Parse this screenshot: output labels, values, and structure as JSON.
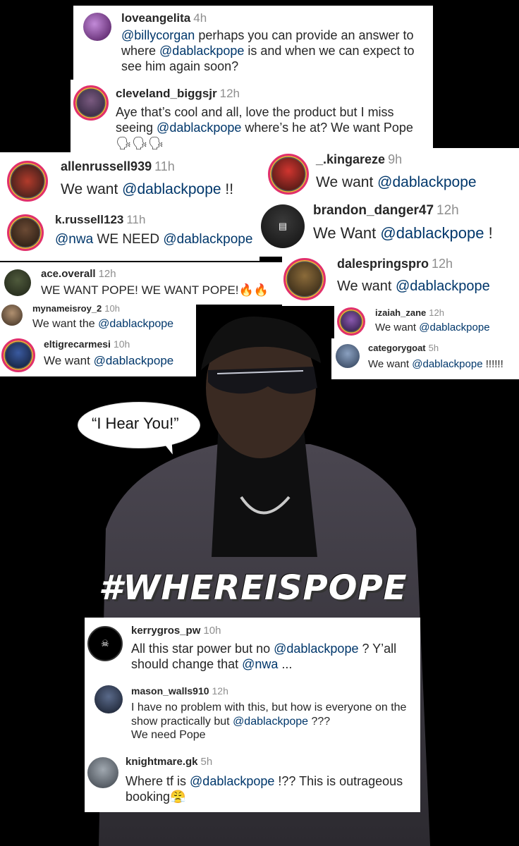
{
  "hashtag": "#WHEREISPOPE",
  "speech_bubble": "“I Hear You!”",
  "comments": {
    "loveangelita": {
      "user": "loveangelita",
      "time": "4h",
      "mention1": "@billycorgan",
      "text1": " perhaps you can provide an answer to where ",
      "mention2": "@dablackpope",
      "text2": " is and when we can expect to see him again soon?"
    },
    "cleveland": {
      "user": "cleveland_biggsjr",
      "time": "12h",
      "text1": "Aye that’s cool and all, love the product but I miss seeing ",
      "mention1": "@dablackpope",
      "text2": " where’s he at? We want Pope",
      "emoji": "🗣🗣🗣"
    },
    "allen": {
      "user": "allenrussell939",
      "time": "11h",
      "text1": "We want ",
      "mention1": "@dablackpope",
      "text2": " !!"
    },
    "kingareze": {
      "user": "_.kingareze",
      "time": "9h",
      "text1": "We want ",
      "mention1": "@dablackpope"
    },
    "krussell": {
      "user": "k.russell123",
      "time": "11h",
      "mention1": "@nwa",
      "text1": " WE NEED ",
      "mention2": "@dablackpope"
    },
    "brandon": {
      "user": "brandon_danger47",
      "time": "12h",
      "text1": "We Want ",
      "mention1": "@dablackpope",
      "text2": " !"
    },
    "ace": {
      "user": "ace.overall",
      "time": "12h",
      "text1": "WE WANT POPE! WE WANT POPE!",
      "emoji": "🔥🔥"
    },
    "dales": {
      "user": "dalespringspro",
      "time": "12h",
      "text1": "We want ",
      "mention1": "@dablackpope"
    },
    "roy": {
      "user": "mynameisroy_2",
      "time": "10h",
      "text1": "We want the ",
      "mention1": "@dablackpope"
    },
    "izaiah": {
      "user": "izaiah_zane",
      "time": "12h",
      "text1": "We want ",
      "mention1": "@dablackpope"
    },
    "eltigre": {
      "user": "eltigrecarmesi",
      "time": "10h",
      "text1": "We want ",
      "mention1": "@dablackpope"
    },
    "goat": {
      "user": "categorygoat",
      "time": "5h",
      "text1": "We want ",
      "mention1": "@dablackpope",
      "text2": " !!!!!!"
    },
    "kerry": {
      "user": "kerrygros_pw",
      "time": "10h",
      "text1": "All this star power but no ",
      "mention1": "@dablackpope",
      "text2": " ? Y’all should change that ",
      "mention2": "@nwa",
      "text3": " ..."
    },
    "mason": {
      "user": "mason_walls910",
      "time": "12h",
      "text1": "I have no problem with this, but how is everyone on the show practically but ",
      "mention1": "@dablackpope",
      "text2": " ???",
      "text3": "We need Pope"
    },
    "knight": {
      "user": "knightmare.gk",
      "time": "5h",
      "text1": "Where tf is ",
      "mention1": "@dablackpope",
      "text2": " !?? This is outrageous booking",
      "emoji": "😤"
    }
  },
  "avatar_icons": {
    "brandon": "referee-icon",
    "kerry": "skull-icon"
  },
  "colors": {
    "background": "#000000",
    "mention": "#00376b",
    "ring": "#e1306c",
    "username": "#262626",
    "timestamp": "#8e8e8e"
  }
}
